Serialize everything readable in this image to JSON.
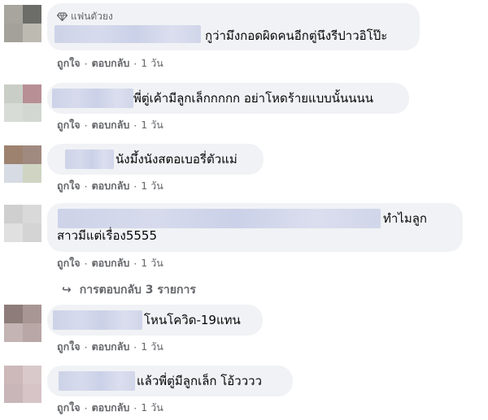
{
  "comments": [
    {
      "badge": "แฟนตัวยง",
      "text": "กูว่ามึงกอดผิดคนอีกตู่นึงรีปาวอิโป๊ะ",
      "like_label": "ถูกใจ",
      "reply_label": "ตอบกลับ",
      "time": "1 วัน",
      "avatar_colors": [
        "#a7a59e",
        "#6c6c68",
        "#a3a199",
        "#bdbab1"
      ]
    },
    {
      "text": "พี่ตู่เค้ามีลูกเล็กกกกก อย่าโหดร้ายแบบนั้นนนน",
      "like_label": "ถูกใจ",
      "reply_label": "ตอบกลับ",
      "time": "1 วัน",
      "avatar_colors": [
        "#c9cfc7",
        "#b78f94",
        "#d8dcd6",
        "#d3d7d2"
      ]
    },
    {
      "text": "นังมึ้งนังสตอเบอรี่ตัวแม่",
      "like_label": "ถูกใจ",
      "reply_label": "ตอบกลับ",
      "time": "1 วัน",
      "avatar_colors": [
        "#9e8270",
        "#a08a80",
        "#d6dbe4",
        "#cfd5c2"
      ]
    },
    {
      "text_line1": "ทำไมลูก",
      "text_line2": "สาวมีแต่เรื่อง5555",
      "like_label": "ถูกใจ",
      "reply_label": "ตอบกลับ",
      "time": "1 วัน",
      "avatar_colors": [
        "#cfcfcf",
        "#d9d9d9",
        "#e0e0e0",
        "#d4d4d4"
      ]
    },
    {
      "text": "โหนโควิด-19แทน",
      "like_label": "ถูกใจ",
      "reply_label": "ตอบกลับ",
      "time": "1 วัน",
      "avatar_colors": [
        "#8e7c7a",
        "#a89694",
        "#c4b4b4",
        "#b9a7a8"
      ]
    },
    {
      "text": "แล้วพี่ตู่มีลูกเล็ก โอ้วววว",
      "like_label": "ถูกใจ",
      "reply_label": "ตอบกลับ",
      "time": "1 วัน",
      "avatar_colors": [
        "#cdb8ba",
        "#d9c9cb",
        "#c8b6b8",
        "#d6c4c7"
      ]
    }
  ],
  "replies_link": {
    "label": "การตอบกลับ 3 รายการ",
    "icon": "reply-arrow-icon"
  },
  "separator": "·"
}
